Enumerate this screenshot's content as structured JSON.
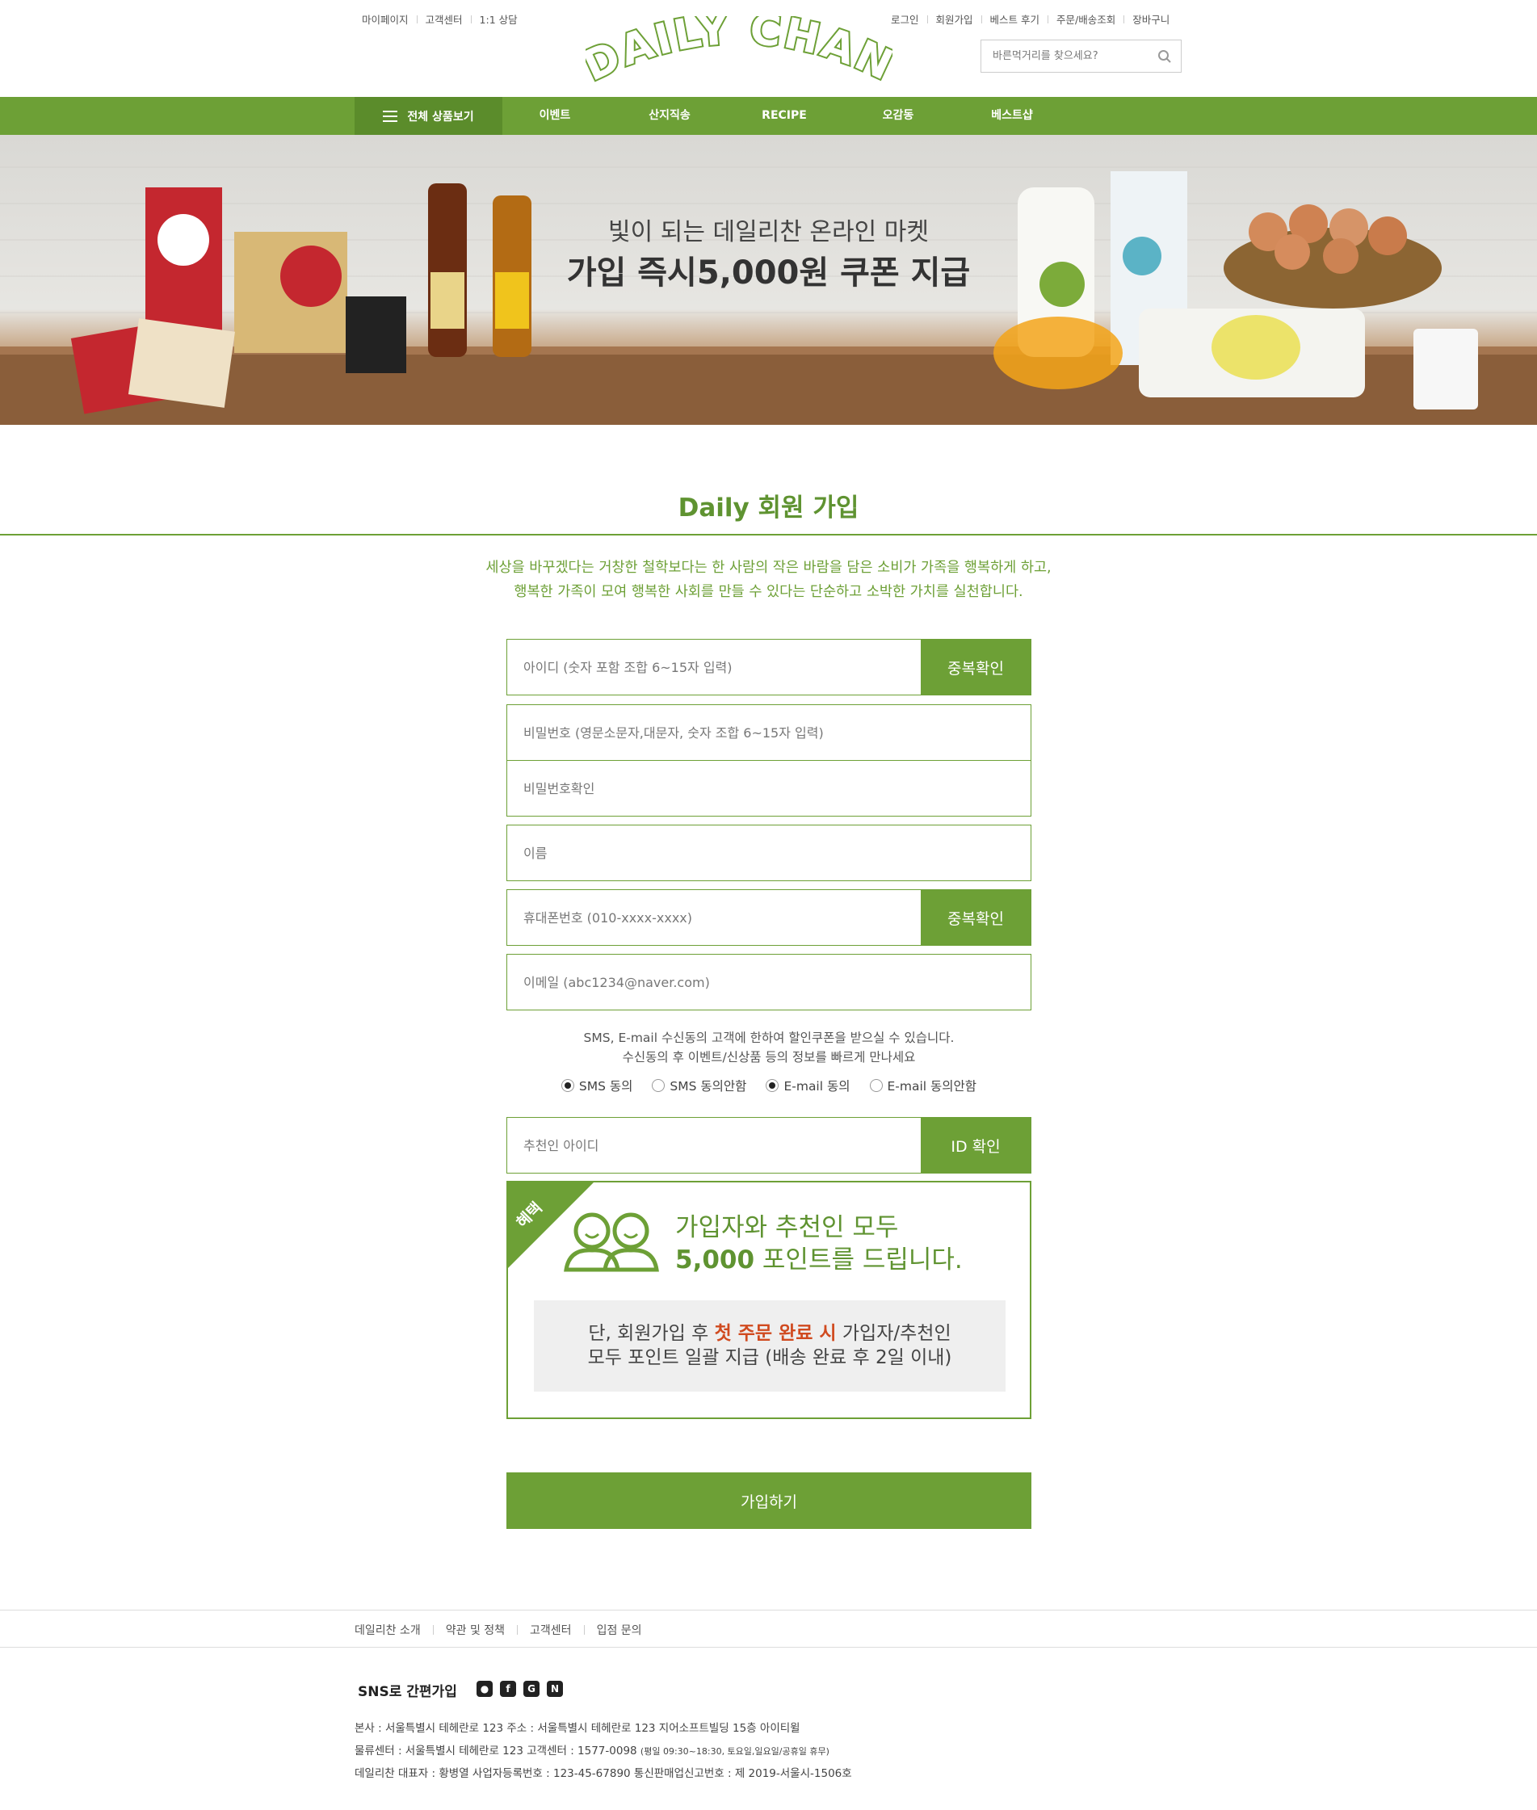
{
  "top_left_links": [
    "마이페이지",
    "고객센터",
    "1:1 상담"
  ],
  "top_right_links": [
    "로그인",
    "회원가입",
    "베스트 후기",
    "주문/배송조회",
    "장바구니"
  ],
  "logo_text": "DAILY CHAN",
  "search": {
    "placeholder": "바른먹거리를 찾으세요?"
  },
  "nav": {
    "all_label": "전체 상품보기",
    "items": [
      "이벤트",
      "산지직송",
      "RECIPE",
      "오감동",
      "베스트샵"
    ]
  },
  "banner": {
    "line1": "빛이 되는 데일리찬 온라인 마켓",
    "line2": "가입 즉시5,000원 쿠폰 지급"
  },
  "signup": {
    "title": "Daily 회원 가입",
    "intro1": "세상을 바꾸겠다는 거창한 철학보다는 한 사람의 작은 바람을 담은 소비가 가족을 행복하게 하고,",
    "intro2": "행복한 가족이 모여 행복한 사회를 만들 수 있다는 단순하고 소박한 가치를 실천합니다.",
    "fields": {
      "id": "아이디 (숫자 포함 조합 6~15자 입력)",
      "password": "비밀번호 (영문소문자,대문자, 숫자 조합 6~15자 입력)",
      "password_confirm": "비밀번호확인",
      "name": "이름",
      "phone": "휴대폰번호 (010-xxxx-xxxx)",
      "email": "이메일 (abc1234@naver.com)",
      "referrer": "추천인 아이디"
    },
    "dup_check_label": "중복확인",
    "id_check_label": "ID 확인",
    "notice1": "SMS, E-mail 수신동의 고객에 한하여 할인쿠폰을 받으실 수 있습니다.",
    "notice2": "수신동의 후 이벤트/신상품 등의 정보를 빠르게 만나세요",
    "radios": [
      {
        "label": "SMS 동의",
        "checked": true
      },
      {
        "label": "SMS 동의안함",
        "checked": false
      },
      {
        "label": "E-mail 동의",
        "checked": true
      },
      {
        "label": "E-mail 동의안함",
        "checked": false
      }
    ],
    "benefit": {
      "ribbon": "혜택",
      "line1": "가입자와 추천인 모두",
      "line2_bold": "5,000",
      "line2_rest": " 포인트를 드립니다.",
      "note_pre": "단, 회원가입 후 ",
      "note_hl": "첫 주문 완료 시",
      "note_post": " 가입자/추천인",
      "note_line2": "모두 포인트 일괄 지급 (배송 완료 후 2일 이내)"
    },
    "submit_label": "가입하기"
  },
  "footer": {
    "links": [
      "데일리찬 소개",
      "약관 및 정책",
      "고객센터",
      "입점 문의"
    ],
    "sns_label": "SNS로 간편가입",
    "sns_icons": [
      "chat-icon",
      "facebook-icon",
      "google-icon",
      "naver-icon"
    ],
    "info1": "본사 : 서울특별시 테헤란로 123    주소 : 서울특별시 테헤란로 123 지어소프트빌딩 15층 아이티윌",
    "info2_main": "물류센터 : 서울특별시 테헤란로 123    고객센터 : 1577-0098 ",
    "info2_small": "(평일 09:30~18:30, 토요일,일요일/공휴일 휴무)",
    "info3": "데일리찬 대표자 : 황병열    사업자등록번호 : 123-45-67890    통신판매업신고번호 : 제 2019-서울시-1506호"
  },
  "colors": {
    "primary": "#6da036",
    "dark": "#5b8c2b",
    "highlight": "#d04a1f"
  }
}
